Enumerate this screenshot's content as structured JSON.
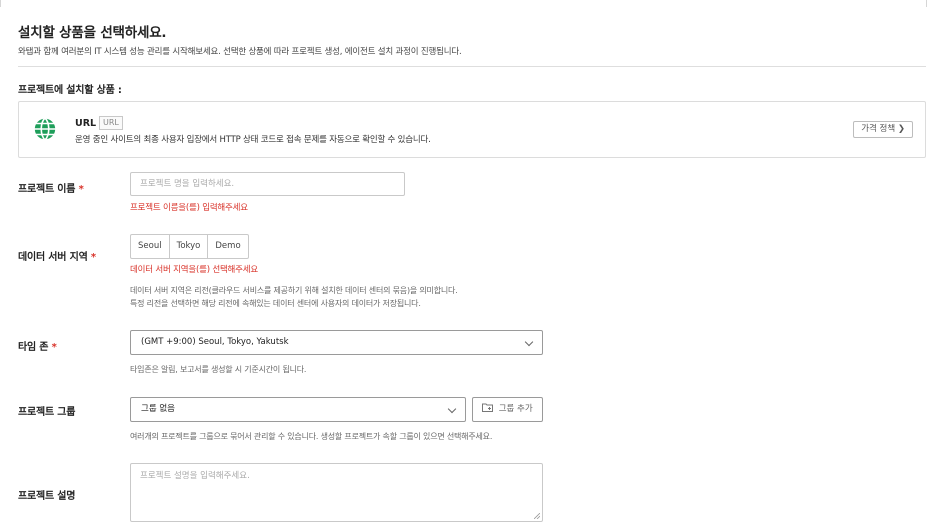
{
  "header": {
    "title": "설치할 상품을 선택하세요.",
    "subtitle": "와탭과 함께 여러분의 IT 시스템 성능 관리를 시작해보세요. 선택한 상품에 따라 프로젝트 생성, 에이전트 설치 과정이 진행됩니다."
  },
  "product_section": {
    "title": "프로젝트에 설치할 상품 :",
    "name": "URL",
    "badge": "URL",
    "description": "운영 중인 사이트의 최종 사용자 입장에서 HTTP 상태 코드로 접속 문제를 자동으로 확인할 수 있습니다.",
    "price_button": "가격 정책  ❯"
  },
  "form": {
    "project_name": {
      "label": "프로젝트 이름",
      "required": "*",
      "placeholder": "프로젝트 명을 입력하세요.",
      "error": "프로젝트 이름을(를) 입력해주세요"
    },
    "region": {
      "label": "데이터 서버 지역",
      "required": "*",
      "options": [
        "Seoul",
        "Tokyo",
        "Demo"
      ],
      "error": "데이터 서버 지역을(를) 선택해주세요",
      "help1": "데이터 서버 지역은 리전(클라우드 서비스를 제공하기 위해 설치한 데이터 센터의 묶음)을 의미합니다.",
      "help2": "특정 리전을 선택하면 해당 리전에 속해있는 데이터 센터에 사용자의 데이터가 저장됩니다."
    },
    "timezone": {
      "label": "타임 존",
      "required": "*",
      "value": "(GMT +9:00) Seoul, Tokyo, Yakutsk",
      "help": "타임존은 알림, 보고서를 생성할 시 기준시간이 됩니다."
    },
    "group": {
      "label": "프로젝트 그룹",
      "value": "그룹 없음",
      "add_button": "그룹 추가",
      "help": "여러개의 프로젝트를 그룹으로 묶어서 관리할 수 있습니다. 생성할 프로젝트가 속할 그룹이 있으면 선택해주세요."
    },
    "description": {
      "label": "프로젝트 설명",
      "placeholder": "프로젝트 설명을 입력해주세요."
    }
  },
  "colors": {
    "error": "#d9342b",
    "globe_green": "#1e9e5a"
  },
  "icons": [
    "globe-icon",
    "chevron-down-icon",
    "folder-plus-icon",
    "resize-handle-icon"
  ]
}
